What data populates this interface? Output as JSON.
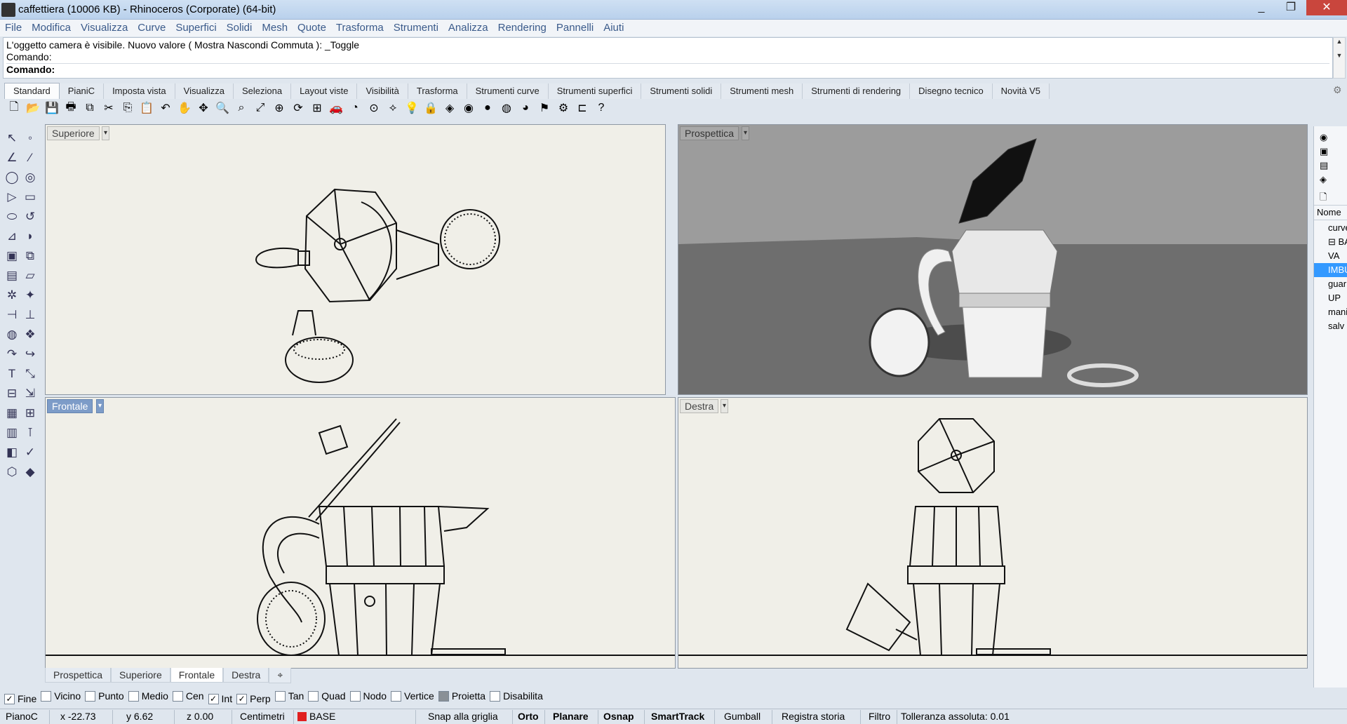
{
  "window": {
    "title": "caffettiera (10006 KB) - Rhinoceros (Corporate) (64-bit)",
    "min": "_",
    "max": "❐",
    "close": "✕"
  },
  "menu": [
    "File",
    "Modifica",
    "Visualizza",
    "Curve",
    "Superfici",
    "Solidi",
    "Mesh",
    "Quote",
    "Trasforma",
    "Strumenti",
    "Analizza",
    "Rendering",
    "Pannelli",
    "Aiuti"
  ],
  "command": {
    "history_line": "L'oggetto camera è visibile. Nuovo valore ( Mostra  Nascondi  Commuta ): _Toggle",
    "prev_prompt": "Comando:",
    "prompt": "Comando:"
  },
  "tabs": [
    {
      "label": "Standard",
      "active": true
    },
    {
      "label": "PianiC"
    },
    {
      "label": "Imposta vista"
    },
    {
      "label": "Visualizza"
    },
    {
      "label": "Seleziona"
    },
    {
      "label": "Layout viste"
    },
    {
      "label": "Visibilità"
    },
    {
      "label": "Trasforma"
    },
    {
      "label": "Strumenti curve"
    },
    {
      "label": "Strumenti superfici"
    },
    {
      "label": "Strumenti solidi"
    },
    {
      "label": "Strumenti mesh"
    },
    {
      "label": "Strumenti di rendering"
    },
    {
      "label": "Disegno tecnico"
    },
    {
      "label": "Novità V5"
    }
  ],
  "toolbar_icons": [
    "new-icon",
    "open-icon",
    "save-icon",
    "print-icon",
    "import-icon",
    "cut-icon",
    "copy-icon",
    "paste-icon",
    "undo-icon",
    "pan-icon",
    "move-view-icon",
    "zoom-icon",
    "zoom-window-icon",
    "zoom-extents-icon",
    "zoom-selected-icon",
    "rotate-view-icon",
    "viewport-layout-icon",
    "car-icon",
    "snapshot-icon",
    "osnap-icon",
    "layer-icon",
    "light-icon",
    "lock-icon",
    "material-icon",
    "color-wheel-icon",
    "shaded-icon",
    "rendered-icon",
    "render-icon",
    "lasso-icon",
    "options-icon",
    "dimension-icon",
    "help-icon"
  ],
  "toolbar_glyphs": [
    "🗋",
    "📂",
    "💾",
    "🖶",
    "⧉",
    "✂",
    "⎘",
    "📋",
    "↶",
    "✋",
    "✥",
    "🔍",
    "⌕",
    "⤢",
    "⊕",
    "⟳",
    "⊞",
    "🚗",
    "◔",
    "⊙",
    "⟡",
    "💡",
    "🔒",
    "◈",
    "◉",
    "●",
    "◍",
    "◕",
    "⚑",
    "⚙",
    "⊏",
    "?"
  ],
  "left_tools": [
    "↖",
    "◦",
    "∠",
    "⁄",
    "◯",
    "◎",
    "▷",
    "▭",
    "⬭",
    "↺",
    "⊿",
    "◗",
    "▣",
    "⧉",
    "▤",
    "▱",
    "✲",
    "✦",
    "⊣",
    "⊥",
    "◍",
    "❖",
    "↷",
    "↪",
    "T",
    "⤡",
    "⊟",
    "⇲",
    "▦",
    "⊞",
    "▥",
    "⊺",
    "◧",
    "✓",
    "⬡",
    "◆"
  ],
  "viewports": {
    "top_left": {
      "title": "Superiore"
    },
    "top_right": {
      "title": "Prospettica"
    },
    "bottom_left": {
      "title": "Frontale"
    },
    "bottom_right": {
      "title": "Destra"
    },
    "dropdown": "▾"
  },
  "viewport_tabs": [
    {
      "label": "Prospettica"
    },
    {
      "label": "Superiore"
    },
    {
      "label": "Frontale",
      "active": true
    },
    {
      "label": "Destra"
    },
    {
      "label": "⌖"
    }
  ],
  "layers_panel": {
    "header": "Nome",
    "items": [
      {
        "label": "curve"
      },
      {
        "label": "⊟ BASE"
      },
      {
        "label": "VA"
      },
      {
        "label": "IMBU",
        "selected": true
      },
      {
        "label": "guar"
      },
      {
        "label": "UP"
      },
      {
        "label": "mani"
      },
      {
        "label": "salv"
      }
    ]
  },
  "osnap": [
    {
      "label": "Fine",
      "checked": true
    },
    {
      "label": "Vicino",
      "checked": false
    },
    {
      "label": "Punto",
      "checked": false
    },
    {
      "label": "Medio",
      "checked": false
    },
    {
      "label": "Cen",
      "checked": false
    },
    {
      "label": "Int",
      "checked": true
    },
    {
      "label": "Perp",
      "checked": true
    },
    {
      "label": "Tan",
      "checked": false
    },
    {
      "label": "Quad",
      "checked": false
    },
    {
      "label": "Nodo",
      "checked": false
    },
    {
      "label": "Vertice",
      "checked": false
    },
    {
      "label": "Proietta",
      "checked": false,
      "grey": true
    },
    {
      "label": "Disabilita",
      "checked": false
    }
  ],
  "status": {
    "plane": "PianoC",
    "x": "x -22.73",
    "y": "y 6.62",
    "z": "z 0.00",
    "units": "Centimetri",
    "layer": "BASE",
    "layer_color": "#e02020",
    "grid_snap": "Snap alla griglia",
    "ortho": "Orto",
    "planar": "Planare",
    "osnap": "Osnap",
    "smarttrack": "SmartTrack",
    "gumball": "Gumball",
    "history": "Registra storia",
    "filter": "Filtro",
    "tolerance": "Tolleranza assoluta: 0.01"
  },
  "colors": {
    "active_tab_blue": "#7d9cc8",
    "selection_blue": "#3399ff",
    "close_red": "#c9463d"
  }
}
